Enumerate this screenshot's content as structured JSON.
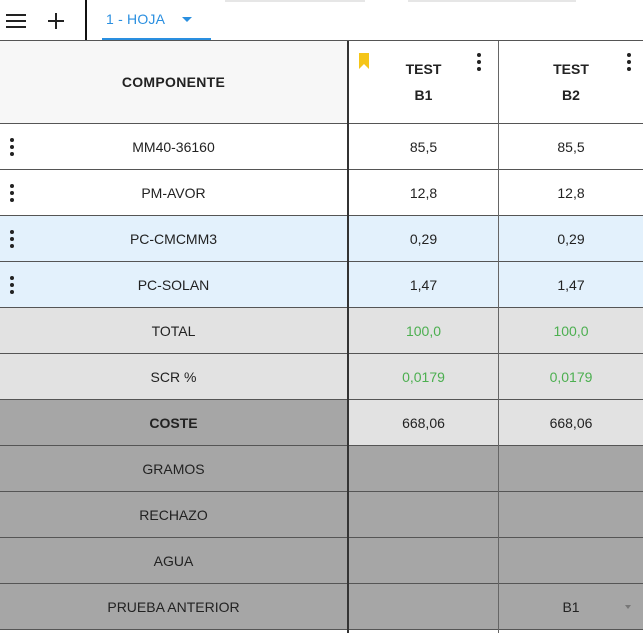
{
  "toolbar": {
    "menu_icon": "hamburger-menu-icon",
    "add_icon": "plus-icon",
    "tab_label": "1 - HOJA"
  },
  "header": {
    "component_label": "COMPONENTE",
    "columns": [
      {
        "line1": "TEST",
        "line2": "B1",
        "bookmarked": true
      },
      {
        "line1": "TEST",
        "line2": "B2",
        "bookmarked": false
      }
    ]
  },
  "rows": [
    {
      "label": "MM40-36160",
      "values": [
        "85,5",
        "85,5"
      ],
      "menu": true
    },
    {
      "label": "PM-AVOR",
      "values": [
        "12,8",
        "12,8"
      ],
      "menu": true
    },
    {
      "label": "PC-CMCMM3",
      "values": [
        "0,29",
        "0,29"
      ],
      "menu": true
    },
    {
      "label": "PC-SOLAN",
      "values": [
        "1,47",
        "1,47"
      ],
      "menu": true
    },
    {
      "label": "TOTAL",
      "values": [
        "100,0",
        "100,0"
      ]
    },
    {
      "label": "SCR %",
      "values": [
        "0,0179",
        "0,0179"
      ]
    },
    {
      "label": "COSTE",
      "values": [
        "668,06",
        "668,06"
      ]
    },
    {
      "label": "GRAMOS",
      "values": [
        "",
        ""
      ]
    },
    {
      "label": "RECHAZO",
      "values": [
        "",
        ""
      ]
    },
    {
      "label": "AGUA",
      "values": [
        "",
        ""
      ]
    },
    {
      "label": "PRUEBA ANTERIOR",
      "values": [
        "",
        "B1"
      ]
    }
  ],
  "colors": {
    "accent": "#2a8fe0",
    "row_white": "#ffffff",
    "row_blue": "#e3f1fc",
    "row_light_gray": "#e2e2e2",
    "row_dark_gray": "#a6a6a6",
    "value_green": "#4caf50",
    "bookmark": "#f5c518"
  }
}
